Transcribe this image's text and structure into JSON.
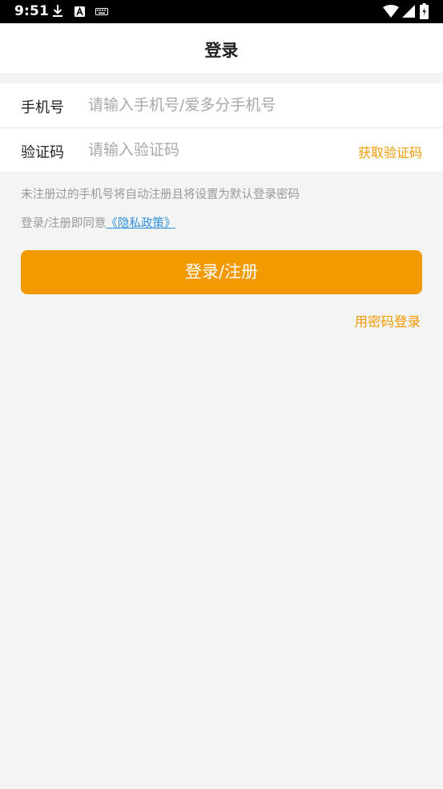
{
  "status_bar": {
    "time": "9:51",
    "icons": [
      "download-icon",
      "a-notification-icon",
      "keyboard-icon",
      "wifi-icon",
      "signal-icon",
      "battery-icon"
    ]
  },
  "header": {
    "title": "登录"
  },
  "form": {
    "phone": {
      "label": "手机号",
      "value": "",
      "placeholder": "请输入手机号/爱多分手机号"
    },
    "code": {
      "label": "验证码",
      "value": "",
      "placeholder": "请输入验证码",
      "get_code_label": "获取验证码"
    }
  },
  "notice_text": "未注册过的手机号将自动注册且将设置为默认登录密码",
  "agreement": {
    "prefix": "登录/注册即同意",
    "link": "《隐私政策》"
  },
  "submit_label": "登录/注册",
  "password_login_label": "用密码登录",
  "colors": {
    "accent": "#f29a00",
    "link": "#2f8fdc",
    "background": "#f4f4f4"
  }
}
